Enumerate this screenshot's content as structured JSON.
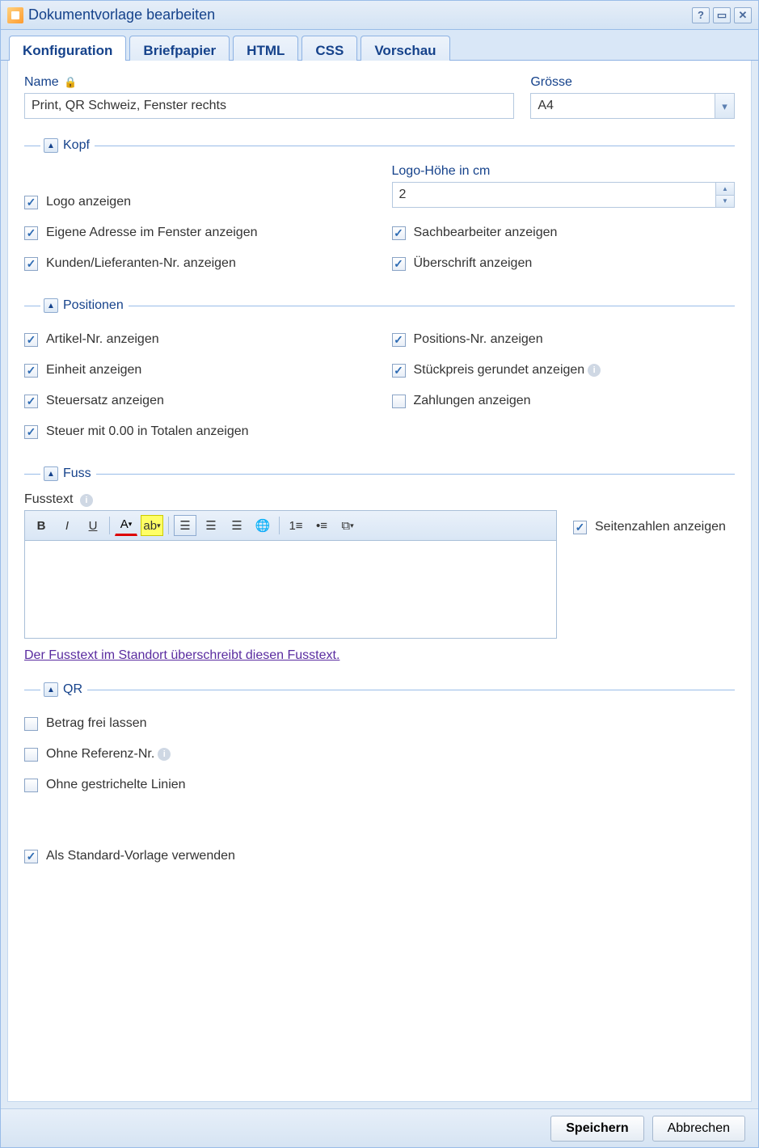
{
  "window": {
    "title": "Dokumentvorlage bearbeiten"
  },
  "tabs": [
    "Konfiguration",
    "Briefpapier",
    "HTML",
    "CSS",
    "Vorschau"
  ],
  "fields": {
    "name_label": "Name",
    "name_value": "Print, QR Schweiz, Fenster rechts",
    "size_label": "Grösse",
    "size_value": "A4"
  },
  "sections": {
    "kopf": {
      "title": "Kopf",
      "logo_height_label": "Logo-Höhe in cm",
      "logo_height_value": "2",
      "checks": {
        "logo": "Logo anzeigen",
        "eigene": "Eigene Adresse im Fenster anzeigen",
        "sach": "Sachbearbeiter anzeigen",
        "kunden": "Kunden/Lieferanten-Nr. anzeigen",
        "uber": "Überschrift anzeigen"
      }
    },
    "pos": {
      "title": "Positionen",
      "checks": {
        "artikel": "Artikel-Nr. anzeigen",
        "posnr": "Positions-Nr. anzeigen",
        "einheit": "Einheit anzeigen",
        "stueck": "Stückpreis gerundet anzeigen",
        "steuersatz": "Steuersatz anzeigen",
        "zahlungen": "Zahlungen anzeigen",
        "steuer0": "Steuer mit 0.00 in Totalen anzeigen"
      }
    },
    "fuss": {
      "title": "Fuss",
      "fusstext_label": "Fusstext",
      "seiten": "Seitenzahlen anzeigen",
      "link": "Der Fusstext im Standort überschreibt diesen Fusstext."
    },
    "qr": {
      "title": "QR",
      "checks": {
        "betrag": "Betrag frei lassen",
        "ohneref": "Ohne Referenz-Nr.",
        "ohnelin": "Ohne gestrichelte Linien"
      }
    },
    "standard": "Als Standard-Vorlage verwenden"
  },
  "footer": {
    "save": "Speichern",
    "cancel": "Abbrechen"
  }
}
